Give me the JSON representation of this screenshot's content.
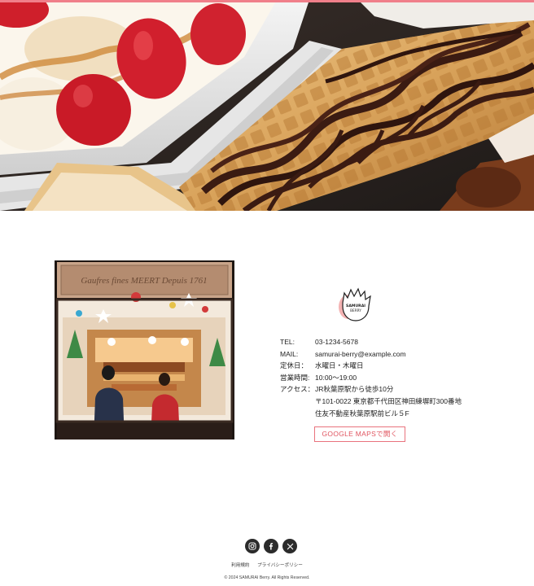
{
  "hero": {
    "image_subject": "waffles with strawberries, cream and chocolate"
  },
  "shop_photo": {
    "image_subject": "waffle shop storefront",
    "sign_text": "Gaufres fines   MEERT   Depuis 1761"
  },
  "logo": {
    "text_line1": "SAMURAI",
    "text_line2": "BERRY"
  },
  "info": [
    {
      "label": "TEL:",
      "value": "03-1234-5678"
    },
    {
      "label": "MAIL:",
      "value": "samurai-berry@example.com"
    },
    {
      "label": "定休日：",
      "value": "水曜日・木曜日"
    },
    {
      "label": "営業時間:",
      "value": "10:00〜19:00"
    },
    {
      "label": "アクセス：",
      "value": "JR秋葉原駅から徒歩10分"
    },
    {
      "label": "",
      "value": "〒101-0022 東京都千代田区神田練塀町300番地"
    },
    {
      "label": "",
      "value": "住友不動産秋葉原駅前ビル５F"
    }
  ],
  "map_button": {
    "label": "GOOGLE MAPSで開く"
  },
  "social": [
    {
      "icon": "instagram-icon"
    },
    {
      "icon": "facebook-icon"
    },
    {
      "icon": "x-icon"
    }
  ],
  "footer": {
    "links": [
      "利用規約",
      "プライバシーポリシー"
    ],
    "copyright": "© 2024 SAMURAI Berry. All Rights Reserved."
  },
  "colors": {
    "accent": "#e9737d",
    "dark": "#2b2b2b",
    "chocolate": "#3b1b12",
    "waffle": "#d9a35b"
  }
}
